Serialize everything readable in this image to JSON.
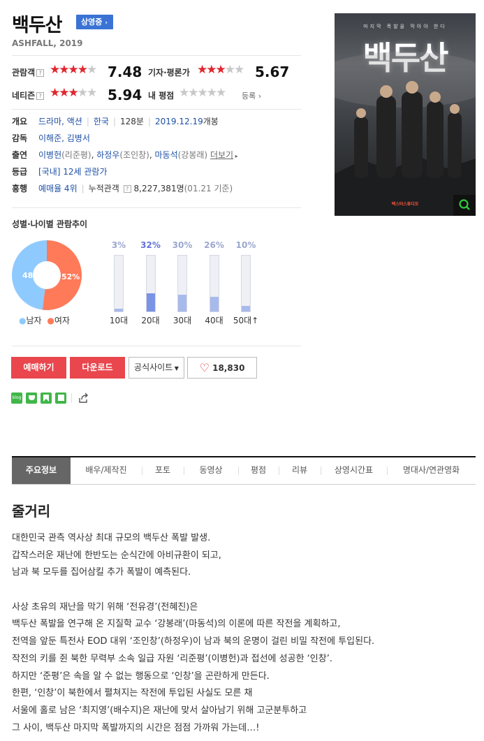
{
  "movie": {
    "title": "백두산",
    "status_badge": "상영중",
    "subtitle": "ASHFALL, 2019"
  },
  "ratings": {
    "audience": {
      "label": "관람객",
      "score": "7.48",
      "stars": 3.74
    },
    "critics": {
      "label": "기자·평론가",
      "score": "5.67",
      "stars": 2.84
    },
    "netizen": {
      "label": "네티즌",
      "score": "5.94",
      "stars": 2.97
    },
    "my_rating": {
      "label": "내 평점",
      "action": "등록"
    }
  },
  "info": {
    "overview": {
      "key": "개요",
      "genre": "드라마, 액션",
      "country": "한국",
      "runtime": "128분",
      "release_date": "2019.12.19",
      "release_suffix": "개봉"
    },
    "director": {
      "key": "감독",
      "value": "이해준, 김병서"
    },
    "cast": {
      "key": "출연",
      "actors": [
        {
          "name": "이병헌",
          "role": "(리준평)"
        },
        {
          "name": "하정우",
          "role": "(조인창)"
        },
        {
          "name": "마동석",
          "role": "(강봉래)"
        }
      ],
      "more": "더보기"
    },
    "grade": {
      "key": "등급",
      "value": "[국내] 12세 관람가"
    },
    "box_office": {
      "key": "흥행",
      "rank": "예매율 4위",
      "cumulative_label": "누적관객",
      "cumulative_value": "8,227,381명",
      "cumulative_note": "(01.21 기준)"
    }
  },
  "demographics": {
    "title": "성별·나이별 관람추이",
    "gender": {
      "male_pct": 48,
      "female_pct": 52,
      "male_label": "48%",
      "female_label": "52%",
      "male_legend": "남자",
      "female_legend": "여자"
    },
    "ages": [
      {
        "label": "10대",
        "pct": 3,
        "pct_label": "3%"
      },
      {
        "label": "20대",
        "pct": 32,
        "pct_label": "32%",
        "highlight": true
      },
      {
        "label": "30대",
        "pct": 30,
        "pct_label": "30%"
      },
      {
        "label": "40대",
        "pct": 26,
        "pct_label": "26%"
      },
      {
        "label": "50대↑",
        "pct": 10,
        "pct_label": "10%"
      }
    ],
    "colors": {
      "male": "#8fcaff",
      "female": "#ff7a59",
      "bar": "#a8baec",
      "bar_highlight": "#7b93e6",
      "pct_label": "#9ba7cf",
      "pct_highlight": "#6574d6"
    }
  },
  "actions": {
    "reserve": "예매하기",
    "download": "다운로드",
    "official_site": "공식사이트",
    "likes": "18,830"
  },
  "share_icons": [
    "blog-icon",
    "cafe-icon",
    "bookmark-icon",
    "memo-icon",
    "share-icon"
  ],
  "poster": {
    "tagline": "마지막 폭발을 막아야 한다",
    "title": "백두산",
    "studio": "덱스터스튜디오"
  },
  "tabs": [
    "주요정보",
    "배우/제작진",
    "포토",
    "동영상",
    "평점",
    "리뷰",
    "상영시간표",
    "명대사/연관영화"
  ],
  "synopsis": {
    "heading": "줄거리",
    "lines": [
      "대한민국 관측 역사상 최대 규모의 백두산 폭발 발생.",
      " 갑작스러운 재난에 한반도는 순식간에 아비규환이 되고,",
      " 남과 북 모두를 집어삼킬 추가 폭발이 예측된다.",
      "",
      " 사상 초유의 재난을 막기 위해 ‘전유경’(전혜진)은",
      " 백두산 폭발을 연구해 온 지질학 교수 ‘강봉래’(마동석)의 이론에 따른 작전을 계획하고,",
      " 전역을 앞둔 특전사 EOD 대위 ‘조인창’(하정우)이 남과 북의 운명이 걸린 비밀 작전에 투입된다.",
      " 작전의 키를 쥔 북한 무력부 소속 일급 자원 ‘리준평’(이병헌)과 접선에 성공한 ‘인창’.",
      " 하지만 ‘준평’은 속을 알 수 없는 행동으로 ‘인창’을 곤란하게 만든다.",
      " 한편, ‘인창’이 북한에서 펼쳐지는 작전에 투입된 사실도 모른 채",
      " 서울에 홀로 남은 ‘최지영’(배수지)은 재난에 맞서 살아남기 위해 고군분투하고",
      " 그 사이, 백두산 마지막 폭발까지의 시간은 점점 가까워 가는데…!"
    ]
  }
}
